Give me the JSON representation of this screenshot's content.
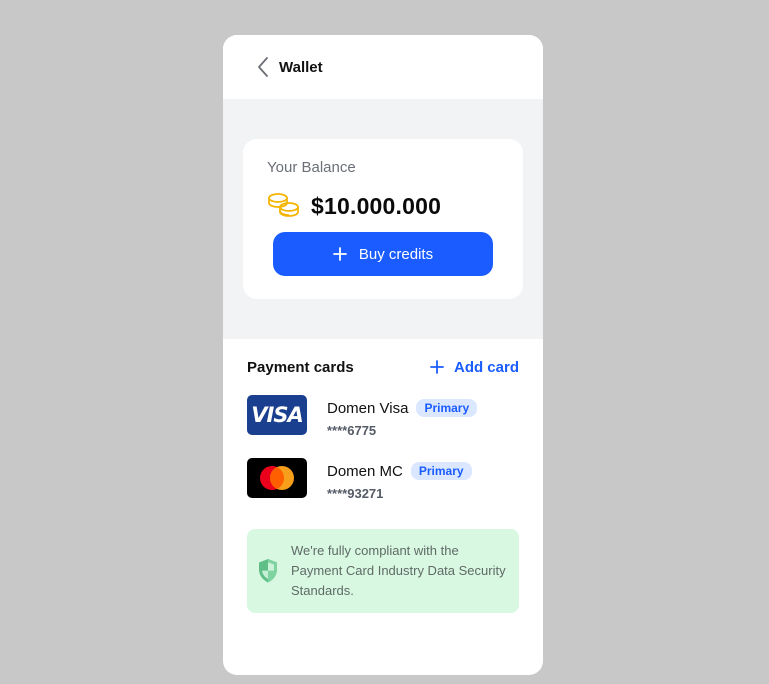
{
  "header": {
    "title": "Wallet",
    "back_icon": "chevron-left-icon"
  },
  "balance": {
    "label": "Your Balance",
    "amount": "$10.000.000",
    "coins_icon": "coins-icon",
    "buy_label": "Buy credits"
  },
  "cards": {
    "title": "Payment cards",
    "add_label": "Add card",
    "items": [
      {
        "brand": "visa",
        "logo_text": "VISA",
        "name": "Domen Visa",
        "badge": "Primary",
        "number": "****6775"
      },
      {
        "brand": "mastercard",
        "name": "Domen MC",
        "badge": "Primary",
        "number": "****93271"
      }
    ]
  },
  "notice": {
    "text": "We're fully compliant with the Payment Card Industry Data Security Standards.",
    "icon": "shield-icon"
  },
  "colors": {
    "accent": "#1a5cff",
    "background": "#c8c8c8",
    "notice_bg": "#d8f8e2",
    "coin": "#f5b400",
    "shield": "#5fbf86"
  }
}
